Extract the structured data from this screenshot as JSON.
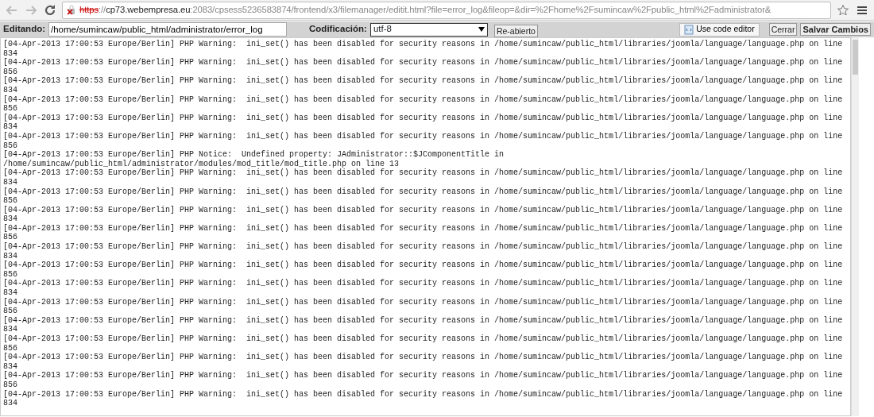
{
  "browser": {
    "address_bar": {
      "scheme": "https",
      "separator": "://",
      "insecure": true,
      "host": "cp73.webempresa.eu",
      "path": ":2083/cpsess5236583874/frontend/x3/filemanager/editit.html?file=error_log&fileop=&dir=%2Fhome%2Fsumincaw%2Fpublic_html%2Fadministrator&"
    }
  },
  "toolbar": {
    "editing_label": "Editando:",
    "file_path": "/home/sumincaw/public_html/administrator/error_log",
    "encoding_label": "Codificación:",
    "encoding": "utf-8",
    "reopen_button": "Re-abierto",
    "code_editor_button": "Use code editor",
    "close_button": "Cerrar",
    "save_button": "Salvar Cambios"
  },
  "log_lines": [
    "[04-Apr-2013 17:00:53 Europe/Berlin] PHP Warning:  ini_set() has been disabled for security reasons in /home/sumincaw/public_html/libraries/joomla/language/language.php on line 834",
    "[04-Apr-2013 17:00:53 Europe/Berlin] PHP Warning:  ini_set() has been disabled for security reasons in /home/sumincaw/public_html/libraries/joomla/language/language.php on line 856",
    "[04-Apr-2013 17:00:53 Europe/Berlin] PHP Warning:  ini_set() has been disabled for security reasons in /home/sumincaw/public_html/libraries/joomla/language/language.php on line 834",
    "[04-Apr-2013 17:00:53 Europe/Berlin] PHP Warning:  ini_set() has been disabled for security reasons in /home/sumincaw/public_html/libraries/joomla/language/language.php on line 856",
    "[04-Apr-2013 17:00:53 Europe/Berlin] PHP Warning:  ini_set() has been disabled for security reasons in /home/sumincaw/public_html/libraries/joomla/language/language.php on line 834",
    "[04-Apr-2013 17:00:53 Europe/Berlin] PHP Warning:  ini_set() has been disabled for security reasons in /home/sumincaw/public_html/libraries/joomla/language/language.php on line 856",
    "[04-Apr-2013 17:00:53 Europe/Berlin] PHP Notice:  Undefined property: JAdministrator::$JComponentTitle in /home/sumincaw/public_html/administrator/modules/mod_title/mod_title.php on line 13",
    "[04-Apr-2013 17:00:53 Europe/Berlin] PHP Warning:  ini_set() has been disabled for security reasons in /home/sumincaw/public_html/libraries/joomla/language/language.php on line 834",
    "[04-Apr-2013 17:00:53 Europe/Berlin] PHP Warning:  ini_set() has been disabled for security reasons in /home/sumincaw/public_html/libraries/joomla/language/language.php on line 856",
    "[04-Apr-2013 17:00:53 Europe/Berlin] PHP Warning:  ini_set() has been disabled for security reasons in /home/sumincaw/public_html/libraries/joomla/language/language.php on line 834",
    "[04-Apr-2013 17:00:53 Europe/Berlin] PHP Warning:  ini_set() has been disabled for security reasons in /home/sumincaw/public_html/libraries/joomla/language/language.php on line 856",
    "[04-Apr-2013 17:00:53 Europe/Berlin] PHP Warning:  ini_set() has been disabled for security reasons in /home/sumincaw/public_html/libraries/joomla/language/language.php on line 834",
    "[04-Apr-2013 17:00:53 Europe/Berlin] PHP Warning:  ini_set() has been disabled for security reasons in /home/sumincaw/public_html/libraries/joomla/language/language.php on line 856",
    "[04-Apr-2013 17:00:53 Europe/Berlin] PHP Warning:  ini_set() has been disabled for security reasons in /home/sumincaw/public_html/libraries/joomla/language/language.php on line 834",
    "[04-Apr-2013 17:00:53 Europe/Berlin] PHP Warning:  ini_set() has been disabled for security reasons in /home/sumincaw/public_html/libraries/joomla/language/language.php on line 856",
    "[04-Apr-2013 17:00:53 Europe/Berlin] PHP Warning:  ini_set() has been disabled for security reasons in /home/sumincaw/public_html/libraries/joomla/language/language.php on line 834",
    "[04-Apr-2013 17:00:53 Europe/Berlin] PHP Warning:  ini_set() has been disabled for security reasons in /home/sumincaw/public_html/libraries/joomla/language/language.php on line 856",
    "[04-Apr-2013 17:00:53 Europe/Berlin] PHP Warning:  ini_set() has been disabled for security reasons in /home/sumincaw/public_html/libraries/joomla/language/language.php on line 834",
    "[04-Apr-2013 17:00:53 Europe/Berlin] PHP Warning:  ini_set() has been disabled for security reasons in /home/sumincaw/public_html/libraries/joomla/language/language.php on line 856",
    "[04-Apr-2013 17:00:53 Europe/Berlin] PHP Warning:  ini_set() has been disabled for security reasons in /home/sumincaw/public_html/libraries/joomla/language/language.php on line 834"
  ]
}
